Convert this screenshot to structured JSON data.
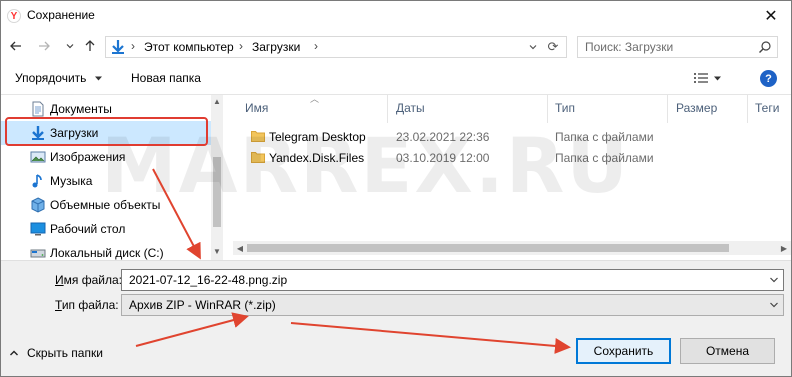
{
  "window": {
    "title": "Сохранение",
    "app_icon_letter": "Y",
    "close_label": "✕"
  },
  "address_bar": {
    "crumbs": [
      "Этот компьютер",
      "Загрузки"
    ],
    "separator": "›",
    "dropdown_glyph": "⌄",
    "refresh_glyph": "⟳"
  },
  "search": {
    "placeholder": "Поиск: Загрузки"
  },
  "toolbar": {
    "organize_label": "Упорядочить",
    "new_folder_label": "Новая папка",
    "help_label": "?"
  },
  "sidebar": {
    "selected": "Загрузки",
    "items": [
      {
        "label": "Документы",
        "icon": "documents-icon"
      },
      {
        "label": "Загрузки",
        "icon": "downloads-icon"
      },
      {
        "label": "Изображения",
        "icon": "pictures-icon"
      },
      {
        "label": "Музыка",
        "icon": "music-icon"
      },
      {
        "label": "Объемные объекты",
        "icon": "3d-objects-icon"
      },
      {
        "label": "Рабочий стол",
        "icon": "desktop-icon"
      },
      {
        "label": "Локальный диск (C:)",
        "icon": "drive-icon"
      }
    ]
  },
  "file_list": {
    "columns": [
      "Имя",
      "Даты",
      "Тип",
      "Размер",
      "Теги"
    ],
    "rows": [
      {
        "name": "Telegram Desktop",
        "date": "23.02.2021 22:36",
        "type": "Папка с файлами"
      },
      {
        "name": "Yandex.Disk.Files",
        "date": "03.10.2019 12:00",
        "type": "Папка с файлами"
      }
    ]
  },
  "watermark": "MARREX.RU",
  "form": {
    "filename_label_prefix": "И",
    "filename_label_rest": "мя файла:",
    "filename_value": "2021-07-12_16-22-48.png.zip",
    "filetype_label_prefix": "Т",
    "filetype_label_rest": "ип файла:",
    "filetype_value": "Архив ZIP - WinRAR (*.zip)",
    "hide_folders_label": "Скрыть папки"
  },
  "buttons": {
    "save_prefix": "",
    "save_label": "Сохранить",
    "cancel_label": "Отмена"
  },
  "colors": {
    "selection": "#cce8ff",
    "highlight_box": "#e03c31",
    "annotation_arrow": "#e0442f",
    "accent": "#0078d7",
    "folder": "#f2c55c"
  }
}
